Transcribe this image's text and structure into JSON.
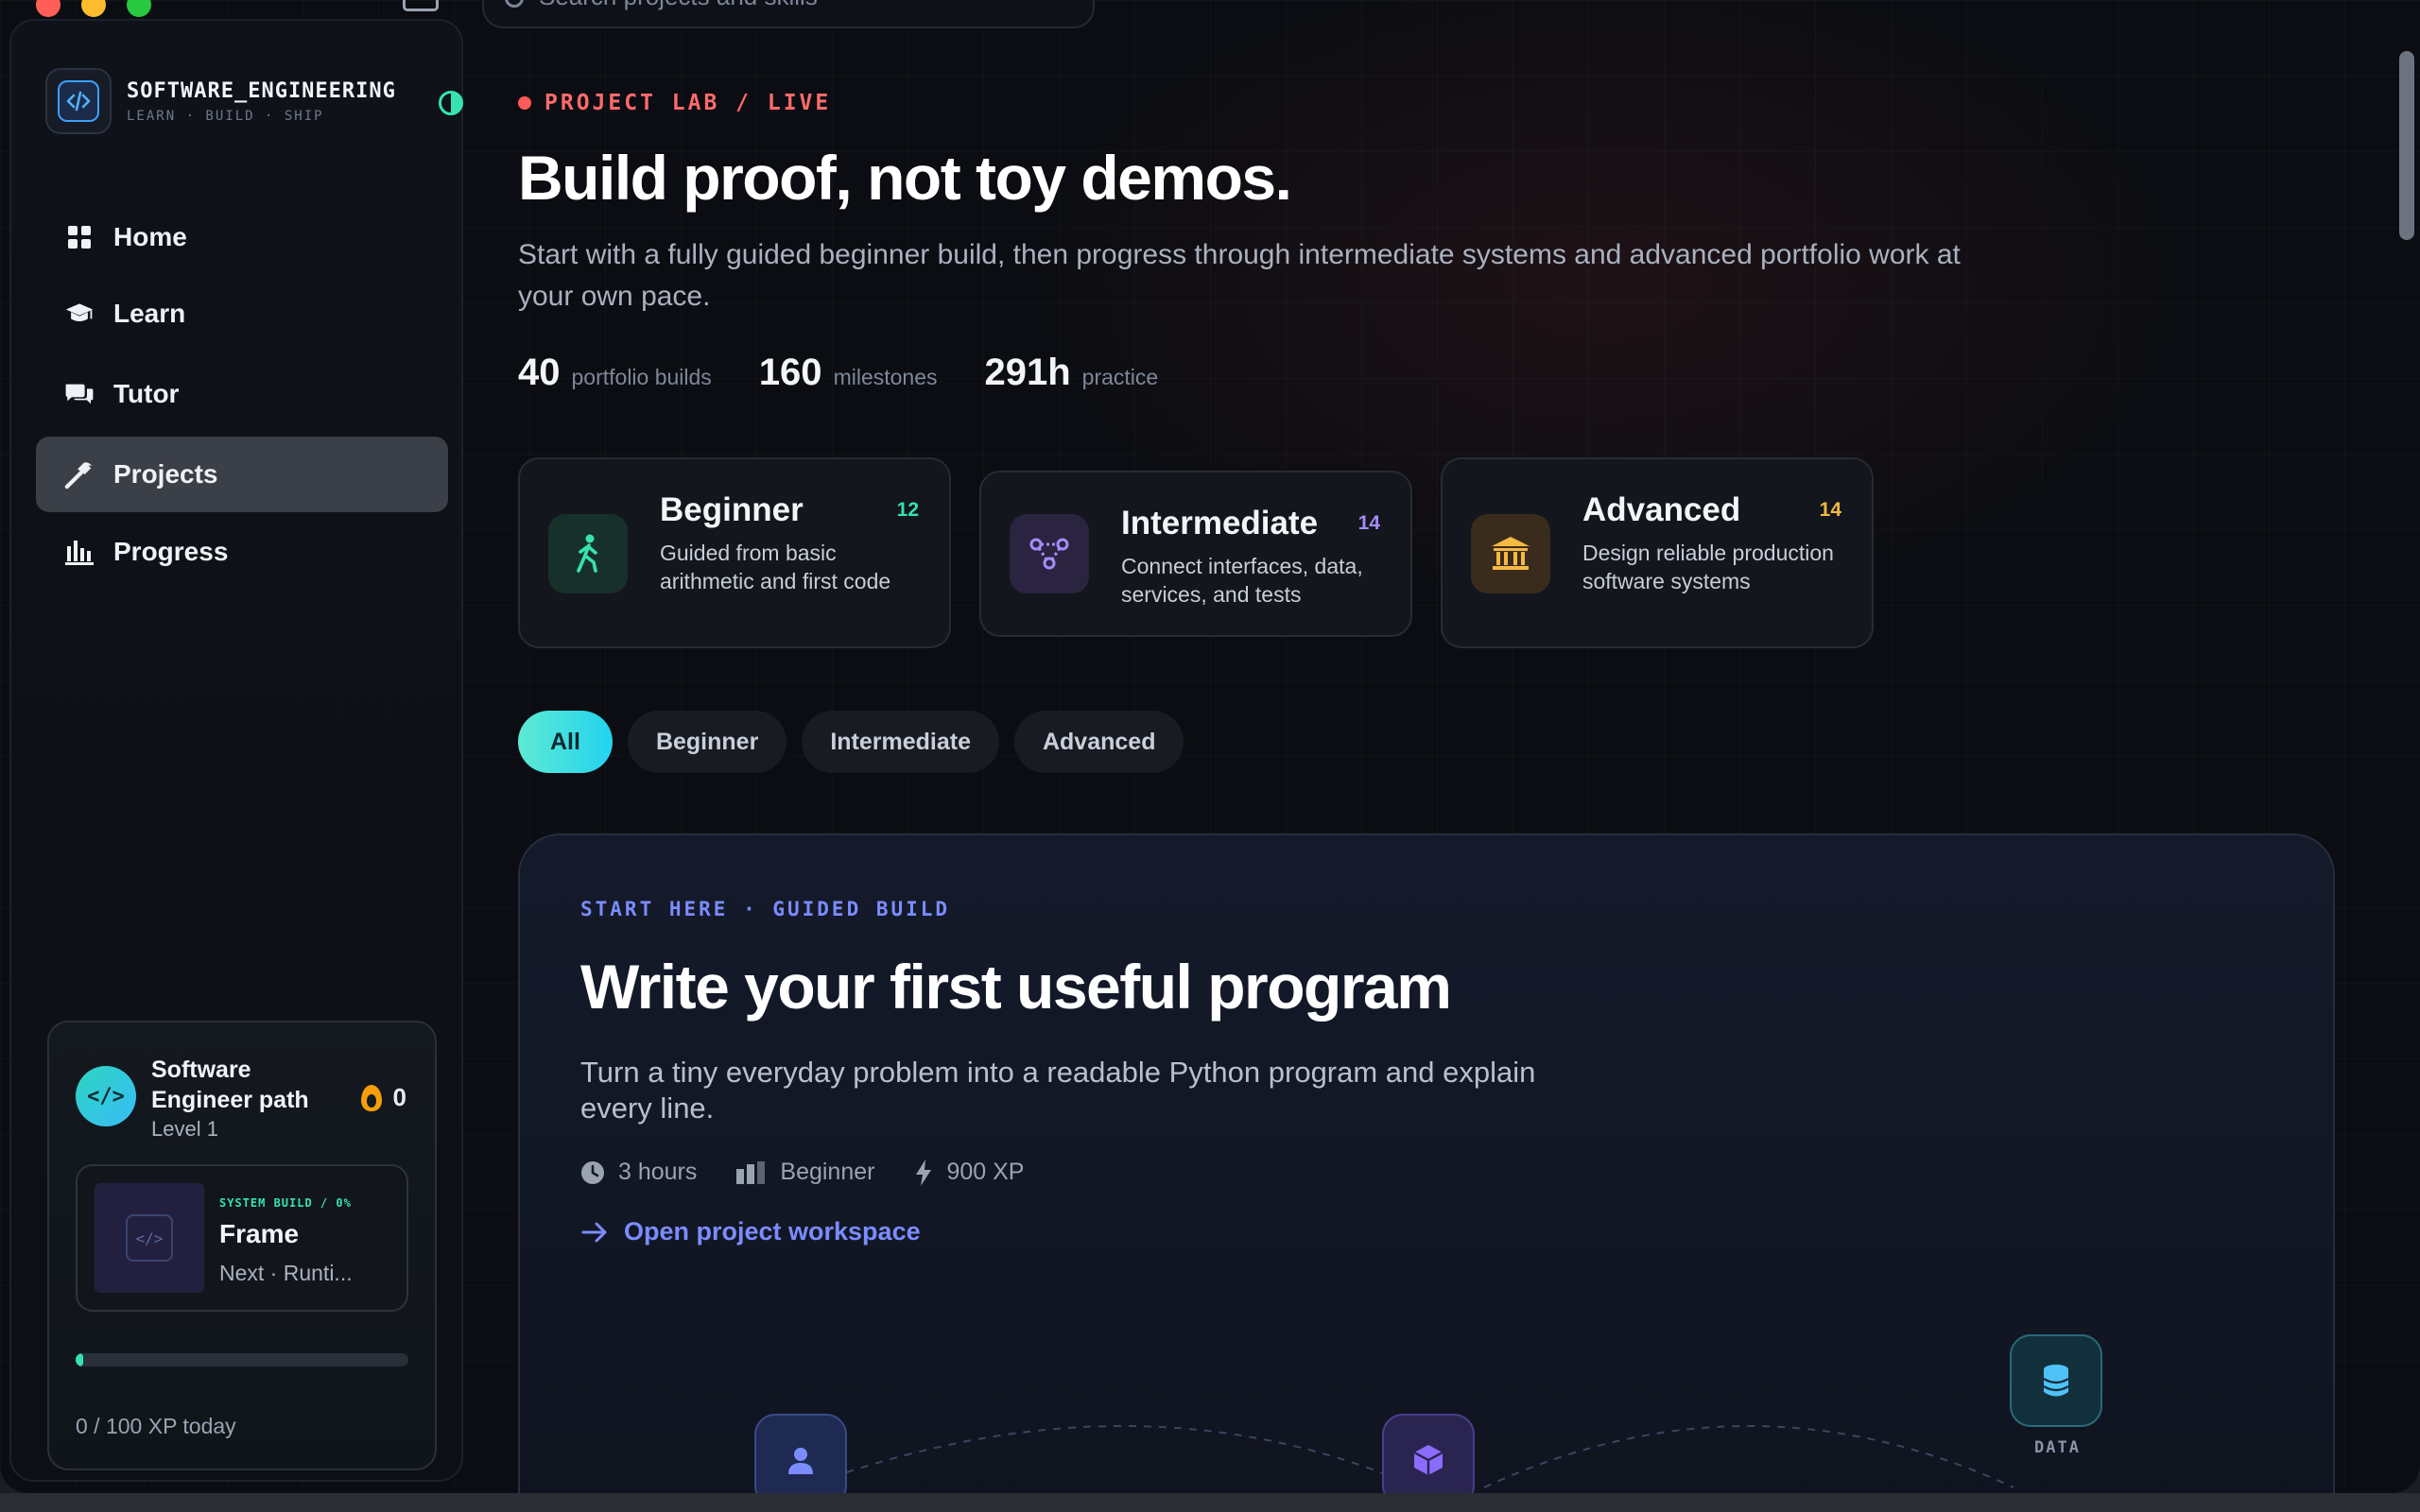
{
  "search": {
    "placeholder": "Search projects and skills"
  },
  "brand": {
    "name": "SOFTWARE_ENGINEERING",
    "tagline": "LEARN · BUILD · SHIP"
  },
  "nav": {
    "items": [
      {
        "label": "Home",
        "icon": "grid-icon",
        "active": false
      },
      {
        "label": "Learn",
        "icon": "graduation-cap-icon",
        "active": false
      },
      {
        "label": "Tutor",
        "icon": "chat-bubbles-icon",
        "active": false
      },
      {
        "label": "Projects",
        "icon": "hammer-icon",
        "active": true
      },
      {
        "label": "Progress",
        "icon": "bar-chart-icon",
        "active": false
      }
    ]
  },
  "path_card": {
    "avatar": "</>",
    "title": "Software Engineer path",
    "level": "Level 1",
    "streak": "0",
    "frame": {
      "kicker": "SYSTEM BUILD / 0%",
      "title": "Frame",
      "next": "Next · Runti..."
    },
    "xp_progress": 0,
    "xp_text": "0 / 100 XP today"
  },
  "hero": {
    "kicker": "PROJECT LAB / LIVE",
    "title": "Build proof, not toy demos.",
    "subtitle": "Start with a fully guided beginner build, then progress through intermediate systems and advanced portfolio work at your own pace.",
    "stats": [
      {
        "value": "40",
        "label": "portfolio builds"
      },
      {
        "value": "160",
        "label": "milestones"
      },
      {
        "value": "291h",
        "label": "practice"
      }
    ]
  },
  "levels": [
    {
      "name": "Beginner",
      "count": "12",
      "desc": "Guided from basic arithmetic and first code",
      "color": "#36e3b0",
      "icon": "walking-person-icon"
    },
    {
      "name": "Intermediate",
      "count": "14",
      "desc": "Connect interfaces, data, services, and tests",
      "color": "#a78bfa",
      "icon": "network-nodes-icon"
    },
    {
      "name": "Advanced",
      "count": "14",
      "desc": "Design reliable production software systems",
      "color": "#f5b942",
      "icon": "institution-icon"
    }
  ],
  "filters": [
    "All",
    "Beginner",
    "Intermediate",
    "Advanced"
  ],
  "featured": {
    "kicker": "START HERE · GUIDED BUILD",
    "title": "Write your first useful program",
    "subtitle": "Turn a tiny everyday problem into a readable Python program and explain every line.",
    "meta": {
      "time": "3 hours",
      "level": "Beginner",
      "xp": "900 XP"
    },
    "link": "Open project workspace",
    "nodes": {
      "data_label": "DATA"
    }
  }
}
